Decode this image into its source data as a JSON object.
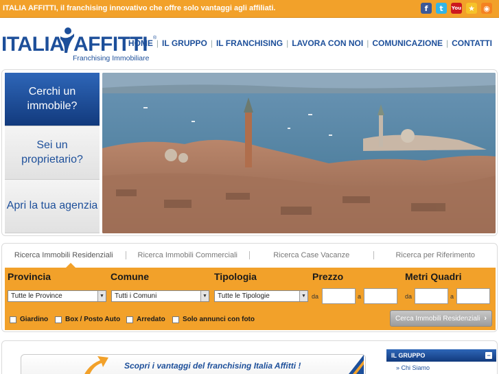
{
  "topbar": {
    "tagline": "ITALIA AFFITTI, il franchising innovativo che offre solo vantaggi agli affiliati.",
    "social": [
      {
        "icon": "facebook-icon",
        "glyph": "f"
      },
      {
        "icon": "twitter-icon",
        "glyph": "t"
      },
      {
        "icon": "youtube-icon",
        "glyph": "You"
      },
      {
        "icon": "favorite-star-icon",
        "glyph": "★"
      },
      {
        "icon": "rss-icon",
        "glyph": "◉"
      }
    ]
  },
  "logo": {
    "word1": "ITALIA",
    "word2": "AFFITTI",
    "registered": "®",
    "subtitle": "Franchising Immobiliare"
  },
  "nav": {
    "items": [
      "HOME",
      "IL GRUPPO",
      "IL FRANCHISING",
      "LAVORA CON NOI",
      "COMUNICAZIONE",
      "CONTATTI"
    ],
    "separator": "|"
  },
  "hero": {
    "tabs": [
      "Cerchi un immobile?",
      "Sei un proprietario?",
      "Apri la tua agenzia"
    ],
    "active_tab": 0
  },
  "search": {
    "tabs": [
      "Ricerca Immobili Residenziali",
      "Ricerca Immobili Commerciali",
      "Ricerca Case Vacanze",
      "Ricerca per Riferimento"
    ],
    "labels": {
      "provincia": "Provincia",
      "comune": "Comune",
      "tipologia": "Tipologia",
      "prezzo": "Prezzo",
      "metri": "Metri Quadri"
    },
    "selects": {
      "provincia": "Tutte le Province",
      "comune": "Tutti i Comuni",
      "tipologia": "Tutte le Tipologie"
    },
    "range": {
      "from": "da",
      "to": "a"
    },
    "checkboxes": [
      "Giardino",
      "Box / Posto Auto",
      "Arredato",
      "Solo annunci con foto"
    ],
    "button": "Cerca Immobili Residenziali",
    "colors": {
      "panel": "#f2a12a"
    }
  },
  "promo": {
    "text": "Scopri i vantaggi del franchising Italia Affitti !"
  },
  "sidebox": {
    "title": "IL GRUPPO",
    "toggle": "−",
    "link": "» Chi Siamo"
  },
  "colors": {
    "brand_blue": "#1d4f9a",
    "accent_orange": "#f2a12a"
  }
}
